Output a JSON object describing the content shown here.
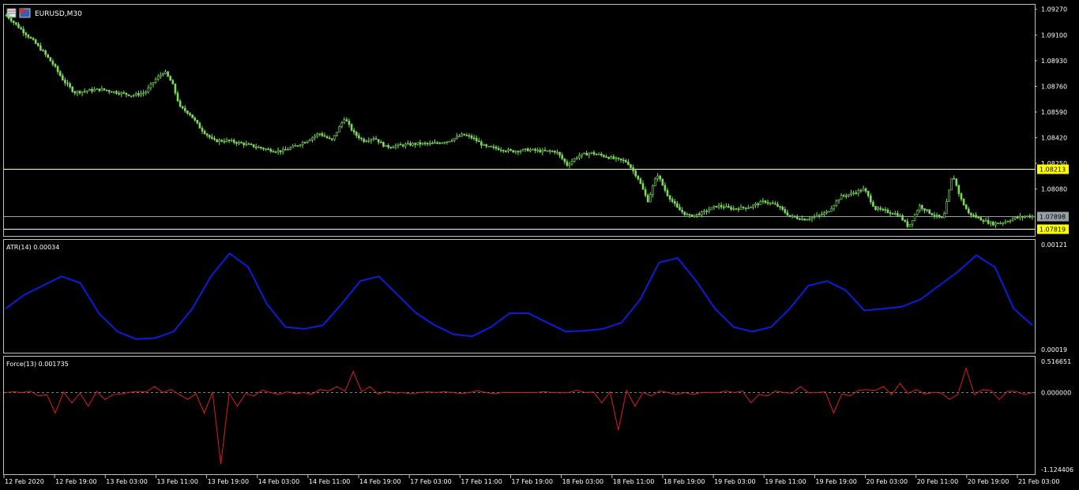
{
  "chart_title": "EURUSD,M30",
  "colors": {
    "background": "#000000",
    "grid_border": "#c0c0c0",
    "candles": "#7ddc5a",
    "atr_line": "#0a1edc",
    "force_line": "#dc1e1e",
    "level_line": "#ffff99",
    "current_price_line": "#9aa0a8",
    "level_tag": "#ffff00",
    "current_tag": "#9aa0a8"
  },
  "icons": [
    "chart-window-icon",
    "symbol-icon"
  ],
  "chart_data": [
    {
      "type": "candlestick",
      "title": "EURUSD,M30",
      "y_ticks": [
        "1.09270",
        "1.09100",
        "1.08930",
        "1.08760",
        "1.08590",
        "1.08420",
        "1.08250",
        "1.08080"
      ],
      "ylim": [
        1.0777,
        1.093
      ],
      "horizontal_levels": [
        {
          "price": "1.08213",
          "label": "1.08213",
          "kind": "level"
        },
        {
          "price": "1.07898",
          "label": "1.07898",
          "kind": "current"
        },
        {
          "price": "1.07819",
          "label": "1.07819",
          "kind": "level"
        }
      ],
      "close_path": [
        [
          0,
          1.0923
        ],
        [
          10,
          1.0918
        ],
        [
          22,
          1.0912
        ],
        [
          34,
          1.0906
        ],
        [
          48,
          1.0898
        ],
        [
          60,
          1.089
        ],
        [
          72,
          1.088
        ],
        [
          86,
          1.0872
        ],
        [
          100,
          1.0873
        ],
        [
          120,
          1.0874
        ],
        [
          140,
          1.0872
        ],
        [
          160,
          1.087
        ],
        [
          176,
          1.0872
        ],
        [
          188,
          1.088
        ],
        [
          200,
          1.0886
        ],
        [
          210,
          1.0878
        ],
        [
          220,
          1.0862
        ],
        [
          232,
          1.0858
        ],
        [
          246,
          1.0848
        ],
        [
          262,
          1.084
        ],
        [
          280,
          1.084
        ],
        [
          300,
          1.0838
        ],
        [
          316,
          1.0836
        ],
        [
          332,
          1.0834
        ],
        [
          348,
          1.0833
        ],
        [
          364,
          1.0836
        ],
        [
          380,
          1.084
        ],
        [
          396,
          1.0845
        ],
        [
          412,
          1.084
        ],
        [
          428,
          1.0855
        ],
        [
          440,
          1.0845
        ],
        [
          452,
          1.084
        ],
        [
          466,
          1.0842
        ],
        [
          480,
          1.0836
        ],
        [
          500,
          1.0837
        ],
        [
          520,
          1.0838
        ],
        [
          540,
          1.0838
        ],
        [
          560,
          1.084
        ],
        [
          578,
          1.0844
        ],
        [
          590,
          1.0842
        ],
        [
          606,
          1.0836
        ],
        [
          620,
          1.0835
        ],
        [
          640,
          1.0833
        ],
        [
          660,
          1.0834
        ],
        [
          680,
          1.0833
        ],
        [
          696,
          1.0833
        ],
        [
          710,
          1.0824
        ],
        [
          724,
          1.083
        ],
        [
          740,
          1.0832
        ],
        [
          756,
          1.083
        ],
        [
          770,
          1.0828
        ],
        [
          786,
          1.0826
        ],
        [
          800,
          1.0815
        ],
        [
          812,
          1.08
        ],
        [
          824,
          1.0818
        ],
        [
          836,
          1.0805
        ],
        [
          850,
          1.0795
        ],
        [
          864,
          1.079
        ],
        [
          880,
          1.0792
        ],
        [
          900,
          1.0797
        ],
        [
          920,
          1.0795
        ],
        [
          940,
          1.0796
        ],
        [
          960,
          1.08
        ],
        [
          976,
          1.0797
        ],
        [
          992,
          1.079
        ],
        [
          1010,
          1.0788
        ],
        [
          1026,
          1.079
        ],
        [
          1040,
          1.0793
        ],
        [
          1056,
          1.0803
        ],
        [
          1070,
          1.0805
        ],
        [
          1086,
          1.0808
        ],
        [
          1100,
          1.0795
        ],
        [
          1116,
          1.0793
        ],
        [
          1130,
          1.0791
        ],
        [
          1142,
          1.0783
        ],
        [
          1156,
          1.0797
        ],
        [
          1170,
          1.0792
        ],
        [
          1186,
          1.0788
        ],
        [
          1198,
          1.0818
        ],
        [
          1208,
          1.0802
        ],
        [
          1218,
          1.0792
        ],
        [
          1234,
          1.0788
        ],
        [
          1248,
          1.0785
        ],
        [
          1262,
          1.0786
        ],
        [
          1278,
          1.0789
        ],
        [
          1292,
          1.079
        ],
        [
          1305,
          1.079
        ]
      ]
    },
    {
      "type": "line",
      "title": "ATR(14) 0.00034",
      "series": [
        {
          "name": "ATR(14)",
          "values": [
            0.0006,
            0.00075,
            0.00085,
            0.00095,
            0.00088,
            0.00055,
            0.00035,
            0.00027,
            0.00028,
            0.00035,
            0.0006,
            0.00095,
            0.0012,
            0.00105,
            0.00065,
            0.0004,
            0.00038,
            0.00042,
            0.00065,
            0.0009,
            0.00095,
            0.00075,
            0.00055,
            0.00042,
            0.00032,
            0.0003,
            0.0004,
            0.00055,
            0.00055,
            0.00045,
            0.00035,
            0.00036,
            0.00038,
            0.00045,
            0.0007,
            0.0011,
            0.00115,
            0.0009,
            0.0006,
            0.0004,
            0.00035,
            0.0004,
            0.0006,
            0.00085,
            0.0009,
            0.0008,
            0.00058,
            0.0006,
            0.00062,
            0.0007,
            0.00085,
            0.001,
            0.00118,
            0.00105,
            0.0006,
            0.00042
          ]
        }
      ],
      "y_ticks": [
        "0.00121",
        "0.00019"
      ],
      "ylim": [
        0.00019,
        0.00121
      ]
    },
    {
      "type": "line",
      "title": "Force(13) 0.001735",
      "series": [
        {
          "name": "Force(13)",
          "values": [
            0.0,
            0.0,
            -0.05,
            -0.3,
            -0.15,
            -0.2,
            -0.1,
            -0.02,
            0.02,
            0.1,
            0.05,
            -0.1,
            -0.3,
            -1.05,
            -0.2,
            -0.05,
            0.0,
            0.01,
            0.0,
            0.05,
            0.1,
            0.35,
            0.1,
            0.02,
            0.0,
            0.0,
            0.0,
            0.0,
            0.0,
            0.0,
            0.0,
            0.0,
            0.0,
            0.0,
            0.0,
            0.0,
            -0.15,
            -0.55,
            -0.2,
            -0.05,
            0.0,
            0.0,
            0.0,
            0.0,
            0.0,
            -0.15,
            -0.05,
            0.0,
            0.1,
            0.0,
            -0.3,
            -0.05,
            0.05,
            0.1,
            0.15,
            0.05,
            0.0,
            -0.1,
            0.4,
            0.05,
            -0.1,
            0.02,
            0.0
          ]
        }
      ],
      "y_ticks": [
        "0.516651",
        "0.000000",
        "-1.124406"
      ],
      "ylim": [
        -1.124406,
        0.516651
      ]
    }
  ],
  "x_ticks": [
    "12 Feb 2020",
    "12 Feb 19:00",
    "13 Feb 03:00",
    "13 Feb 11:00",
    "13 Feb 19:00",
    "14 Feb 03:00",
    "14 Feb 11:00",
    "14 Feb 19:00",
    "17 Feb 03:00",
    "17 Feb 11:00",
    "17 Feb 19:00",
    "18 Feb 03:00",
    "18 Feb 11:00",
    "18 Feb 19:00",
    "19 Feb 03:00",
    "19 Feb 11:00",
    "19 Feb 19:00",
    "20 Feb 03:00",
    "20 Feb 11:00",
    "20 Feb 19:00",
    "21 Feb 03:00"
  ]
}
